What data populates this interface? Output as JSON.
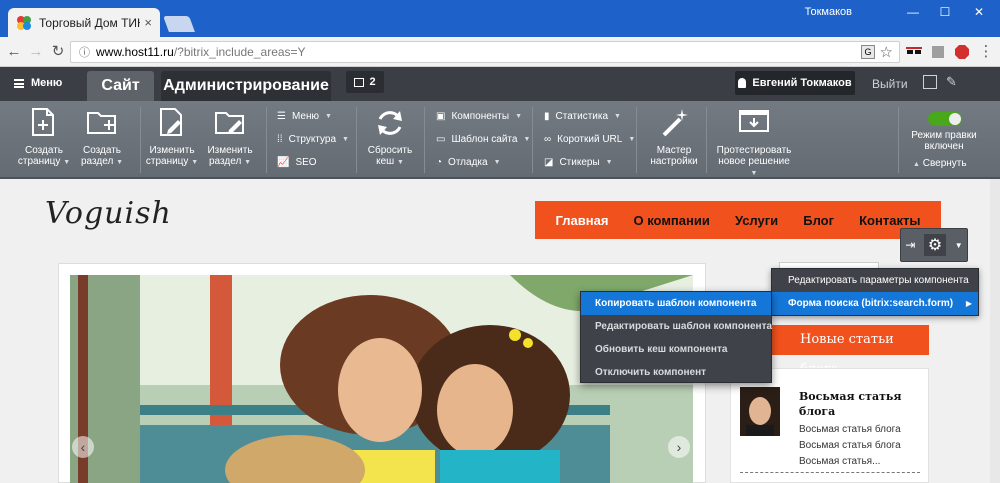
{
  "browser": {
    "tab_title": "Торговый Дом ТИНКО",
    "tab_close": "×",
    "user": "Токмаков",
    "url_host": "www.host11.ru",
    "url_path": "/?bitrix_include_areas=Y"
  },
  "admin": {
    "menu_label": "Меню",
    "tab_site": "Сайт",
    "tab_admin": "Администрирование",
    "notifications": "2",
    "user_name": "Евгений Токмаков",
    "logout": "Выйти"
  },
  "toolbar": {
    "create_page": [
      "Создать",
      "страницу"
    ],
    "create_section": [
      "Создать",
      "раздел"
    ],
    "edit_page": [
      "Изменить",
      "страницу"
    ],
    "edit_section": [
      "Изменить",
      "раздел"
    ],
    "menu": "Меню",
    "structure": "Структура",
    "seo": "SEO",
    "clear_cache": [
      "Сбросить",
      "кеш"
    ],
    "components": "Компоненты",
    "site_template": "Шаблон сайта",
    "debug": "Отладка",
    "statistics": "Статистика",
    "short_url": "Короткий URL",
    "stickers": "Стикеры",
    "wizard": [
      "Мастер",
      "настройки"
    ],
    "test_solution": [
      "Протестировать",
      "новое решение"
    ],
    "edit_mode": [
      "Режим правки",
      "включен"
    ],
    "collapse": "Свернуть"
  },
  "site": {
    "logo": "Voguish",
    "nav": [
      "Главная",
      "О компании",
      "Услуги",
      "Блог",
      "Контакты"
    ],
    "blog_heading": "Новые статьи блога",
    "post_title": "Восьмая статья блога",
    "post_lines": [
      "Восьмая статья блога",
      "Восьмая статья блога",
      "Восьмая статья..."
    ]
  },
  "context_menu": {
    "items": [
      "Редактировать параметры компонента",
      "Форма поиска (bitrix:search.form)"
    ]
  },
  "submenu": {
    "items": [
      "Копировать шаблон компонента",
      "Редактировать шаблон компонента",
      "Обновить кеш компонента",
      "Отключить компонент"
    ]
  },
  "colors": {
    "browser_blue": "#1e62c9",
    "accent_orange": "#f1511c",
    "menu_highlight": "#1477d8",
    "toggle_green": "#49a71b"
  }
}
